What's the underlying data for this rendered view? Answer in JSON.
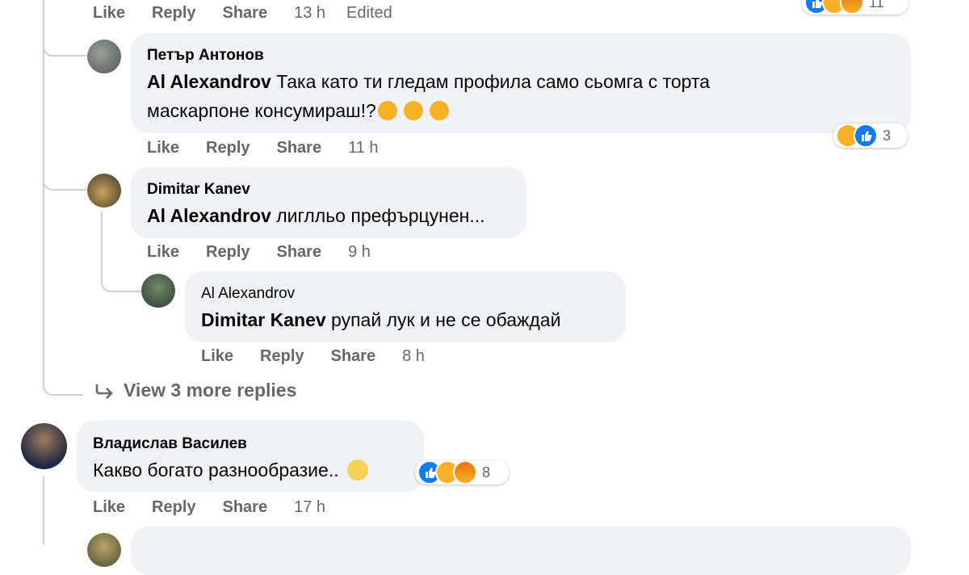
{
  "common": {
    "like": "Like",
    "reply": "Reply",
    "share": "Share"
  },
  "top": {
    "time": "13 h",
    "edited": "Edited",
    "reaction_count": "11"
  },
  "comments": [
    {
      "author": "Петър Антонов",
      "mention": "Al Alexandrov",
      "line1": " Така като ти гледам профила само сьомга с торта",
      "line2": "маскарпоне консумираш!?",
      "time": "11 h",
      "reaction_count": "3"
    },
    {
      "author": "Dimitar Kanev",
      "mention": "Al Alexandrov",
      "line1": " лиглльо префърцунен...",
      "time": "9 h"
    },
    {
      "author": "Al Alexandrov",
      "mention": "Dimitar Kanev",
      "line1": " рупай лук и не се обаждай",
      "time": "8 h"
    },
    {
      "author": "Владислав Василев",
      "line1": "Какво богато разнообразие..",
      "time": "17 h",
      "reaction_count": "8"
    }
  ],
  "view_more": "View 3 more replies",
  "icons": [
    "like-icon",
    "haha-icon",
    "angry-icon",
    "reply-arrow-icon",
    "eyeroll-icon"
  ],
  "colors": {
    "bubble": "#f0f2f5",
    "meta": "#65676b",
    "like_blue": "#1877f2",
    "haha_yellow": "#f7b125"
  }
}
